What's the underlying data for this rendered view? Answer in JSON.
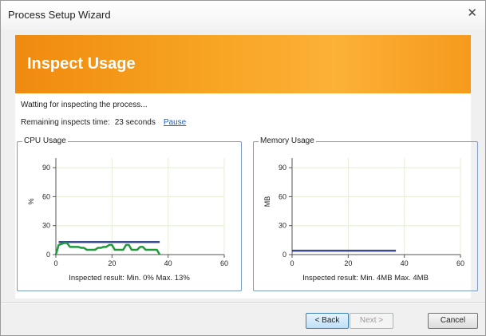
{
  "window": {
    "title": "Process Setup Wizard"
  },
  "banner": {
    "title": "Inspect Usage"
  },
  "status": {
    "message": "Watting for inspecting the process...",
    "remaining_label": "Remaining inspects time:",
    "remaining_value": "23 seconds",
    "pause_link": "Pause"
  },
  "buttons": {
    "back": "< Back",
    "next": "Next >",
    "cancel": "Cancel"
  },
  "colors": {
    "banner": "#f7a321",
    "max_line": "#3b4a8c",
    "usage_line": "#1f9a3a",
    "grid": "#e4eed6"
  },
  "chart_data": [
    {
      "type": "line",
      "title": "CPU Usage",
      "ylabel": "%",
      "xlim": [
        0,
        60
      ],
      "ylim": [
        0,
        100
      ],
      "x_ticks": [
        0,
        20,
        40,
        60
      ],
      "y_ticks": [
        0,
        30,
        60,
        90
      ],
      "series": [
        {
          "name": "max",
          "x": [
            1,
            37
          ],
          "y": [
            13,
            13
          ]
        },
        {
          "name": "usage",
          "x": [
            0,
            1,
            2,
            3,
            4,
            5,
            6,
            7,
            8,
            9,
            10,
            11,
            12,
            13,
            14,
            15,
            16,
            17,
            18,
            19,
            20,
            21,
            22,
            23,
            24,
            25,
            26,
            27,
            28,
            29,
            30,
            31,
            32,
            33,
            34,
            35,
            36,
            37
          ],
          "y": [
            0,
            10,
            11,
            12,
            12,
            8,
            8,
            8,
            8,
            7,
            7,
            5,
            5,
            5,
            5,
            7,
            7,
            8,
            8,
            10,
            10,
            5,
            5,
            5,
            5,
            10,
            10,
            5,
            5,
            5,
            8,
            8,
            5,
            5,
            5,
            5,
            5,
            0
          ]
        }
      ],
      "result_text": "Inspected result: Min. 0% Max. 13%"
    },
    {
      "type": "line",
      "title": "Memory Usage",
      "ylabel": "MB",
      "xlim": [
        0,
        60
      ],
      "ylim": [
        0,
        100
      ],
      "x_ticks": [
        0,
        20,
        40,
        60
      ],
      "y_ticks": [
        0,
        30,
        60,
        90
      ],
      "series": [
        {
          "name": "usage",
          "x": [
            0,
            37
          ],
          "y": [
            4,
            4
          ]
        }
      ],
      "result_text": "Inspected result: Min. 4MB Max. 4MB"
    }
  ]
}
